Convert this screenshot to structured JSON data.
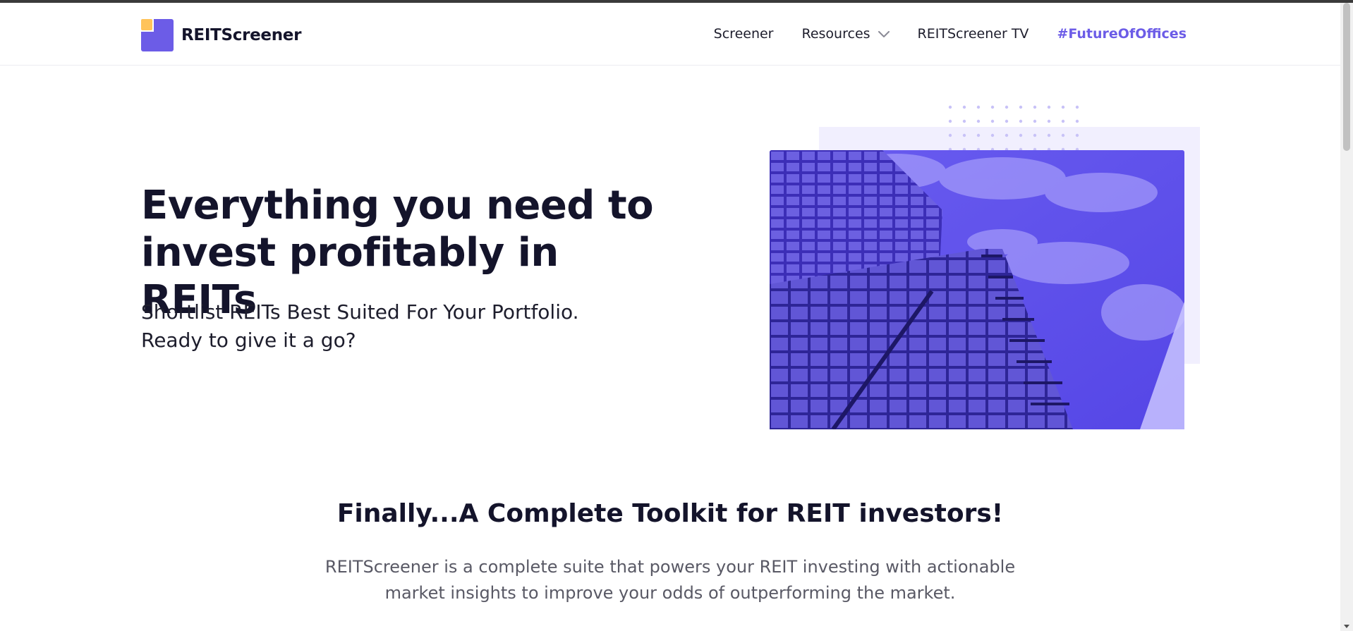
{
  "brand": {
    "name": "REITScreener",
    "purple": "#6c5ce7",
    "yellow": "#ffc35a"
  },
  "nav": {
    "items": [
      {
        "label": "Screener"
      },
      {
        "label": "Resources",
        "icon": "chevron-down-icon"
      },
      {
        "label": "REITScreener TV"
      },
      {
        "label": "#FutureOfOffices",
        "accent": true
      }
    ]
  },
  "hero": {
    "title": "Everything you need to invest profitably in REITs",
    "subtitle_line1": "Shortlist REITs Best Suited For Your Portfolio.",
    "subtitle_line2": "Ready to give it a go?"
  },
  "section": {
    "title": "Finally...A Complete Toolkit for REIT investors!",
    "body": "REITScreener is a complete suite that powers your REIT investing with actionable market insights to improve your odds of outperforming the market."
  }
}
